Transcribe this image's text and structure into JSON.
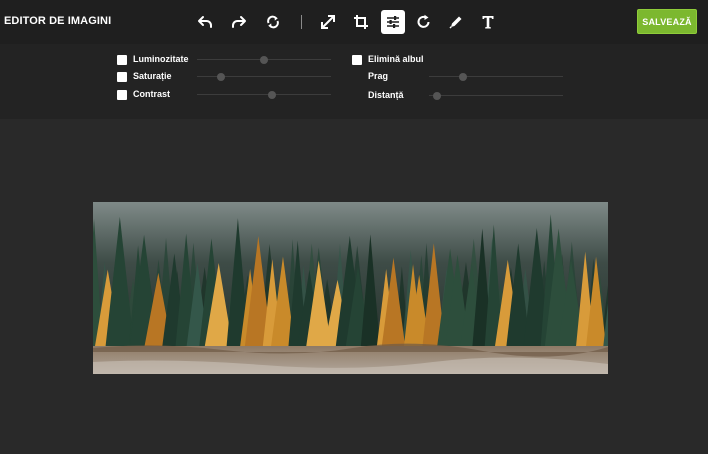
{
  "app": {
    "title": "EDITOR DE IMAGINI",
    "save_label": "SALVEAZĂ",
    "save_color": "#7cb82f"
  },
  "toolbar": {
    "tools": [
      {
        "name": "undo-icon",
        "active": false
      },
      {
        "name": "redo-icon",
        "active": false
      },
      {
        "name": "reset-icon",
        "active": false
      },
      {
        "name": "resize-icon",
        "active": false
      },
      {
        "name": "crop-icon",
        "active": false
      },
      {
        "name": "adjust-icon",
        "active": true
      },
      {
        "name": "rotate-icon",
        "active": false
      },
      {
        "name": "draw-icon",
        "active": false
      },
      {
        "name": "text-icon",
        "active": false
      }
    ]
  },
  "adjust": {
    "brightness": {
      "label": "Luminozitate",
      "checked": true,
      "value": 0.5
    },
    "saturation": {
      "label": "Saturație",
      "checked": true,
      "value": 0.18
    },
    "contrast": {
      "label": "Contrast",
      "checked": true,
      "value": 0.56
    },
    "remove_white": {
      "label": "Elimină albul",
      "checked": true
    },
    "threshold": {
      "label": "Prag",
      "value": 0.25
    },
    "distance": {
      "label": "Distanță",
      "value": 0.06
    }
  },
  "image": {
    "subject": "forest-photo"
  }
}
